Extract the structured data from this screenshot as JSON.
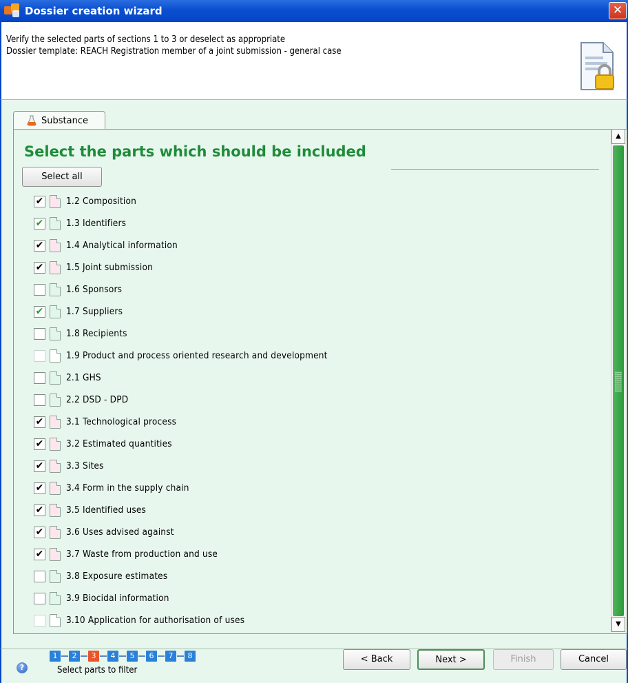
{
  "window": {
    "title": "Dossier creation wizard",
    "close_glyph": "✕"
  },
  "header": {
    "line1": "Verify the selected parts of sections 1 to 3 or deselect as appropriate",
    "line2": "Dossier template: REACH Registration member of a joint submission - general case",
    "icon": "document-lock-icon"
  },
  "tab": {
    "label": "Substance",
    "icon": "flask-icon"
  },
  "section": {
    "heading": "Select the parts which should be included",
    "select_all_label": "Select all"
  },
  "items": [
    {
      "label": "1.2 Composition",
      "checked": true,
      "check_color": "black",
      "doc": "pink",
      "enabled": true
    },
    {
      "label": "1.3 Identifiers",
      "checked": true,
      "check_color": "green",
      "doc": "green",
      "enabled": true
    },
    {
      "label": "1.4 Analytical information",
      "checked": true,
      "check_color": "black",
      "doc": "pink",
      "enabled": true
    },
    {
      "label": "1.5 Joint submission",
      "checked": true,
      "check_color": "black",
      "doc": "pink",
      "enabled": true
    },
    {
      "label": "1.6 Sponsors",
      "checked": false,
      "doc": "green",
      "enabled": true
    },
    {
      "label": "1.7 Suppliers",
      "checked": true,
      "check_color": "green",
      "doc": "green",
      "enabled": true
    },
    {
      "label": "1.8 Recipients",
      "checked": false,
      "doc": "green",
      "enabled": true
    },
    {
      "label": "1.9 Product and process oriented research and development",
      "checked": false,
      "doc": "white",
      "enabled": false
    },
    {
      "label": "2.1 GHS",
      "checked": false,
      "doc": "green",
      "enabled": true
    },
    {
      "label": "2.2 DSD - DPD",
      "checked": false,
      "doc": "green",
      "enabled": true
    },
    {
      "label": "3.1 Technological process",
      "checked": true,
      "check_color": "black",
      "doc": "pink",
      "enabled": true
    },
    {
      "label": "3.2 Estimated quantities",
      "checked": true,
      "check_color": "black",
      "doc": "pink",
      "enabled": true
    },
    {
      "label": "3.3 Sites",
      "checked": true,
      "check_color": "black",
      "doc": "pink",
      "enabled": true
    },
    {
      "label": "3.4 Form in the supply chain",
      "checked": true,
      "check_color": "black",
      "doc": "pink",
      "enabled": true
    },
    {
      "label": "3.5 Identified uses",
      "checked": true,
      "check_color": "black",
      "doc": "pink",
      "enabled": true
    },
    {
      "label": "3.6 Uses advised against",
      "checked": true,
      "check_color": "black",
      "doc": "pink",
      "enabled": true
    },
    {
      "label": "3.7 Waste from production and use",
      "checked": true,
      "check_color": "black",
      "doc": "pink",
      "enabled": true
    },
    {
      "label": "3.8 Exposure estimates",
      "checked": false,
      "doc": "green",
      "enabled": true
    },
    {
      "label": "3.9 Biocidal information",
      "checked": false,
      "doc": "green",
      "enabled": true
    },
    {
      "label": "3.10 Application for authorisation of uses",
      "checked": false,
      "doc": "white",
      "enabled": false
    }
  ],
  "scrollbar": {
    "up_glyph": "▲",
    "down_glyph": "▼"
  },
  "footer": {
    "help_glyph": "?",
    "steps": [
      "1",
      "2",
      "3",
      "4",
      "5",
      "6",
      "7",
      "8"
    ],
    "current_step": "3",
    "status": "Select parts to filter",
    "buttons": {
      "back": "< Back",
      "next": "Next >",
      "finish": "Finish",
      "cancel": "Cancel"
    }
  },
  "colors": {
    "title_bar": "#0645c4",
    "heading": "#1e8c39",
    "panel_bg": "#e8f7ee",
    "step": "#2b80d9",
    "step_current": "#e8552a",
    "scroll_thumb": "#2b9a3a"
  }
}
